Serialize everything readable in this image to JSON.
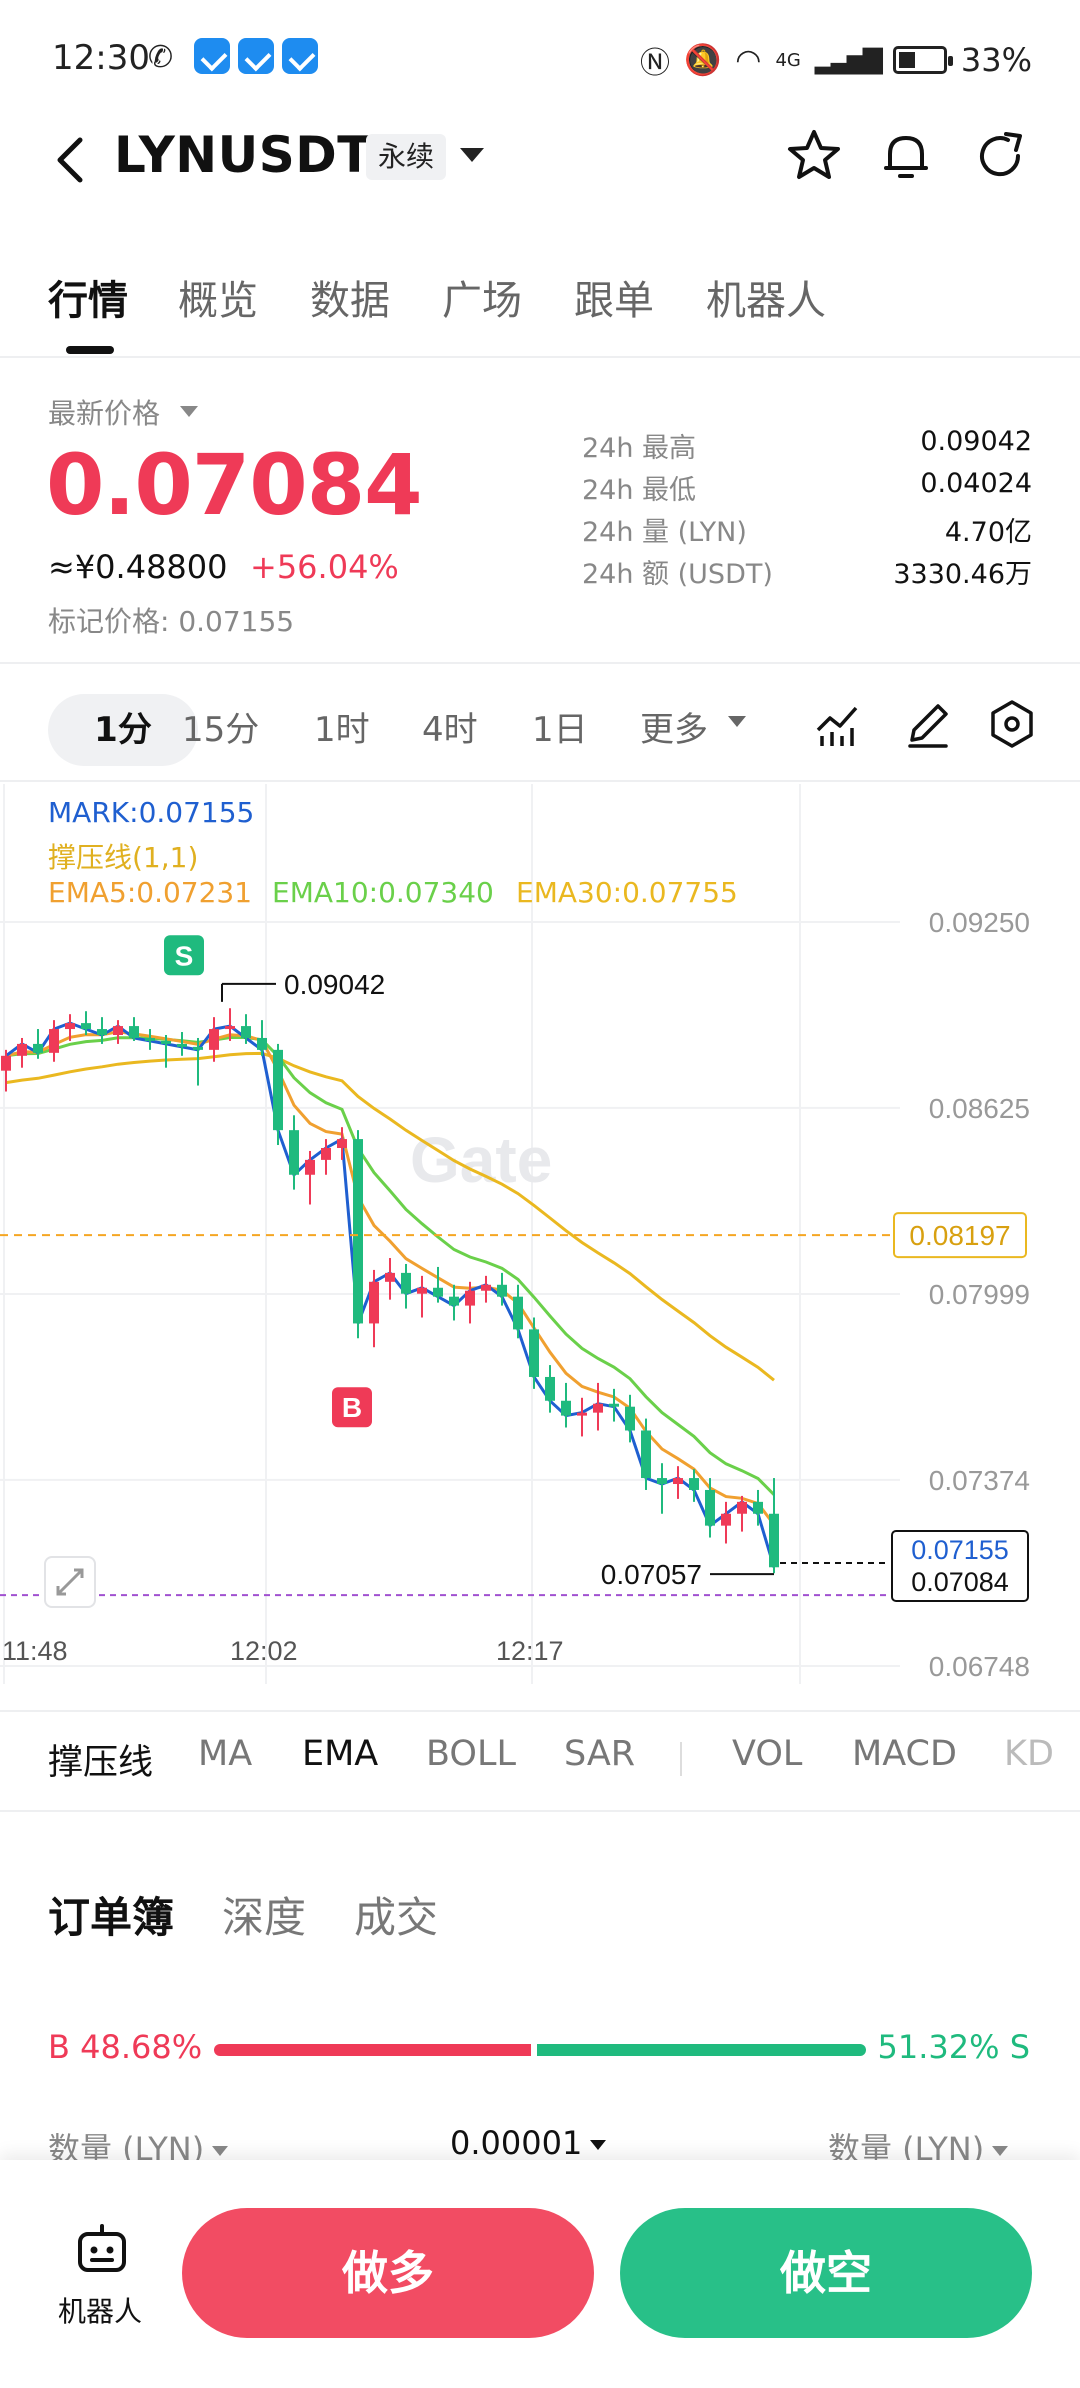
{
  "status_bar": {
    "time": "12:30",
    "network": "4G",
    "battery": "33%"
  },
  "header": {
    "pair": "LYNUSDT",
    "contract_type": "永续"
  },
  "tabs": [
    {
      "label": "行情"
    },
    {
      "label": "概览"
    },
    {
      "label": "数据"
    },
    {
      "label": "广场"
    },
    {
      "label": "跟单"
    },
    {
      "label": "机器人"
    }
  ],
  "price": {
    "latest_label": "最新价格",
    "last": "0.07084",
    "cny": "≈¥0.48800",
    "change": "+56.04%",
    "mark_label": "标记价格: 0.07155"
  },
  "stats": [
    {
      "label": "24h  最高",
      "value": "0.09042"
    },
    {
      "label": "24h  最低",
      "value": "0.04024"
    },
    {
      "label": "24h  量 (LYN)",
      "value": "4.70亿"
    },
    {
      "label": "24h  额 (USDT)",
      "value": "3330.46万"
    }
  ],
  "intervals": [
    {
      "label": "1分"
    },
    {
      "label": "15分"
    },
    {
      "label": "1时"
    },
    {
      "label": "4时"
    },
    {
      "label": "1日"
    },
    {
      "label": "更多"
    }
  ],
  "chart_data": {
    "type": "candlestick",
    "indicators": {
      "mark": "MARK:0.07155",
      "sr_line": "撑压线(1,1)",
      "ema5": "EMA5:0.07231",
      "ema10": "EMA10:0.07340",
      "ema30": "EMA30:0.07755"
    },
    "y_ticks": [
      "0.09250",
      "0.08625",
      "0.07999",
      "0.07374",
      "0.06748"
    ],
    "x_ticks": [
      "11:48",
      "12:02",
      "12:17"
    ],
    "ylim": [
      0.06748,
      0.0925
    ],
    "high_marker": "0.09042",
    "low_marker": "0.07057",
    "level_line": "0.08197",
    "current_mark": "0.07155",
    "current_last": "0.07084",
    "sell_marker": "S",
    "buy_marker": "B",
    "watermark": "Gate",
    "colors": {
      "up": "#ef3a57",
      "down": "#1fba7e",
      "ema5": "#f0a030",
      "ema10": "#6ad04a",
      "ema30": "#eab820",
      "mark": "#1f5fd0"
    },
    "candles": [
      {
        "o": 0.0875,
        "h": 0.0882,
        "l": 0.0868,
        "c": 0.088
      },
      {
        "o": 0.088,
        "h": 0.0886,
        "l": 0.0876,
        "c": 0.0884
      },
      {
        "o": 0.0884,
        "h": 0.0889,
        "l": 0.0879,
        "c": 0.0881
      },
      {
        "o": 0.0881,
        "h": 0.0892,
        "l": 0.0878,
        "c": 0.0889
      },
      {
        "o": 0.0889,
        "h": 0.0894,
        "l": 0.0885,
        "c": 0.0891
      },
      {
        "o": 0.0891,
        "h": 0.0895,
        "l": 0.0887,
        "c": 0.0889
      },
      {
        "o": 0.0889,
        "h": 0.0893,
        "l": 0.0884,
        "c": 0.0887
      },
      {
        "o": 0.0887,
        "h": 0.0892,
        "l": 0.0884,
        "c": 0.089
      },
      {
        "o": 0.089,
        "h": 0.0893,
        "l": 0.0885,
        "c": 0.0886
      },
      {
        "o": 0.0886,
        "h": 0.0889,
        "l": 0.0882,
        "c": 0.0885
      },
      {
        "o": 0.0885,
        "h": 0.0887,
        "l": 0.0876,
        "c": 0.0884
      },
      {
        "o": 0.0884,
        "h": 0.0888,
        "l": 0.088,
        "c": 0.0883
      },
      {
        "o": 0.0883,
        "h": 0.0886,
        "l": 0.087,
        "c": 0.0882
      },
      {
        "o": 0.0882,
        "h": 0.0893,
        "l": 0.0878,
        "c": 0.0889
      },
      {
        "o": 0.0889,
        "h": 0.0896,
        "l": 0.0885,
        "c": 0.089
      },
      {
        "o": 0.089,
        "h": 0.0894,
        "l": 0.0884,
        "c": 0.0886
      },
      {
        "o": 0.0886,
        "h": 0.0892,
        "l": 0.088,
        "c": 0.0882
      },
      {
        "o": 0.0882,
        "h": 0.0884,
        "l": 0.085,
        "c": 0.0855
      },
      {
        "o": 0.0855,
        "h": 0.086,
        "l": 0.0835,
        "c": 0.084
      },
      {
        "o": 0.084,
        "h": 0.0848,
        "l": 0.083,
        "c": 0.0845
      },
      {
        "o": 0.0845,
        "h": 0.0852,
        "l": 0.084,
        "c": 0.0849
      },
      {
        "o": 0.0849,
        "h": 0.0856,
        "l": 0.0845,
        "c": 0.0852
      },
      {
        "o": 0.0852,
        "h": 0.0855,
        "l": 0.0785,
        "c": 0.079
      },
      {
        "o": 0.079,
        "h": 0.0808,
        "l": 0.0782,
        "c": 0.0804
      },
      {
        "o": 0.0804,
        "h": 0.0812,
        "l": 0.0798,
        "c": 0.0807
      },
      {
        "o": 0.0807,
        "h": 0.081,
        "l": 0.0795,
        "c": 0.08
      },
      {
        "o": 0.08,
        "h": 0.0806,
        "l": 0.0792,
        "c": 0.0802
      },
      {
        "o": 0.0802,
        "h": 0.0809,
        "l": 0.0797,
        "c": 0.0799
      },
      {
        "o": 0.0799,
        "h": 0.0803,
        "l": 0.0791,
        "c": 0.0796
      },
      {
        "o": 0.0796,
        "h": 0.0804,
        "l": 0.079,
        "c": 0.0801
      },
      {
        "o": 0.0801,
        "h": 0.0806,
        "l": 0.0797,
        "c": 0.0803
      },
      {
        "o": 0.0803,
        "h": 0.0807,
        "l": 0.0796,
        "c": 0.0799
      },
      {
        "o": 0.0799,
        "h": 0.0803,
        "l": 0.0785,
        "c": 0.0788
      },
      {
        "o": 0.0788,
        "h": 0.0792,
        "l": 0.0768,
        "c": 0.0772
      },
      {
        "o": 0.0772,
        "h": 0.0776,
        "l": 0.076,
        "c": 0.0764
      },
      {
        "o": 0.0764,
        "h": 0.077,
        "l": 0.0755,
        "c": 0.0759
      },
      {
        "o": 0.0759,
        "h": 0.0765,
        "l": 0.0752,
        "c": 0.076
      },
      {
        "o": 0.076,
        "h": 0.077,
        "l": 0.0754,
        "c": 0.0763
      },
      {
        "o": 0.0763,
        "h": 0.0768,
        "l": 0.0757,
        "c": 0.0762
      },
      {
        "o": 0.0762,
        "h": 0.0766,
        "l": 0.075,
        "c": 0.0754
      },
      {
        "o": 0.0754,
        "h": 0.0758,
        "l": 0.0734,
        "c": 0.0738
      },
      {
        "o": 0.0738,
        "h": 0.0743,
        "l": 0.0726,
        "c": 0.0736
      },
      {
        "o": 0.0736,
        "h": 0.0742,
        "l": 0.0731,
        "c": 0.0738
      },
      {
        "o": 0.0738,
        "h": 0.0741,
        "l": 0.073,
        "c": 0.0734
      },
      {
        "o": 0.0734,
        "h": 0.0738,
        "l": 0.0718,
        "c": 0.0722
      },
      {
        "o": 0.0722,
        "h": 0.073,
        "l": 0.0716,
        "c": 0.0726
      },
      {
        "o": 0.0726,
        "h": 0.0732,
        "l": 0.072,
        "c": 0.073
      },
      {
        "o": 0.073,
        "h": 0.0734,
        "l": 0.0722,
        "c": 0.0726
      },
      {
        "o": 0.0726,
        "h": 0.0738,
        "l": 0.0706,
        "c": 0.0708
      }
    ]
  },
  "indicator_tabs": [
    {
      "label": "撑压线"
    },
    {
      "label": "MA"
    },
    {
      "label": "EMA"
    },
    {
      "label": "BOLL"
    },
    {
      "label": "SAR"
    },
    {
      "label": "VOL"
    },
    {
      "label": "MACD"
    },
    {
      "label": "KD"
    }
  ],
  "orderbook": {
    "tabs": [
      {
        "label": "订单簿"
      },
      {
        "label": "深度"
      },
      {
        "label": "成交"
      }
    ],
    "buy_ratio": "B 48.68%",
    "sell_ratio": "51.32% S",
    "buy_pct": 48.68,
    "col_left": "数量 (LYN)",
    "col_mid": "0.00001",
    "col_right": "数量 (LYN)"
  },
  "bottom": {
    "robot_label": "机器人",
    "long_label": "做多",
    "short_label": "做空"
  }
}
